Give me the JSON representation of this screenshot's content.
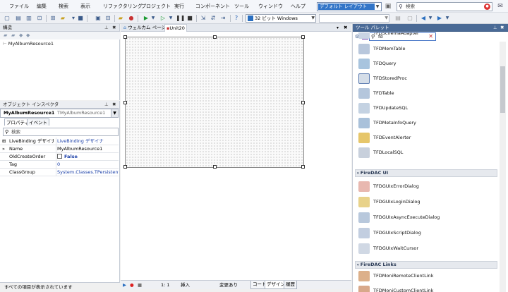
{
  "menu": [
    "ファイル",
    "編集",
    "検索",
    "表示",
    "リファクタリング",
    "プロジェクト",
    "実行",
    "コンポーネント",
    "ツール",
    "ウィンドウ",
    "ヘルプ"
  ],
  "layout_combo": "デフォルト レイアウト",
  "search": {
    "placeholder": "検索"
  },
  "platform_combo": "32 ビット Windows",
  "structure": {
    "title": "構造",
    "tree_item": "MyAlbumResource1"
  },
  "inspector": {
    "title": "オブジェクト インスペクタ",
    "object_name": "MyAlbumResource1",
    "object_type": "TMyAlbumResource1",
    "tabs": [
      "プロパティ",
      "イベント"
    ],
    "search_placeholder": "検索",
    "properties": [
      {
        "mark": "⊞",
        "key": "LiveBinding デザイナ",
        "value": "LiveBinding デザイナ",
        "blue": true
      },
      {
        "mark": "»",
        "key": "Name",
        "value": "MyAlbumResource1",
        "blue": false
      },
      {
        "mark": "",
        "key": "OldCreateOrder",
        "value": "False",
        "blue": true,
        "checkbox": true
      },
      {
        "mark": "",
        "key": "Tag",
        "value": "0",
        "blue": true
      },
      {
        "mark": "",
        "key": "ClassGroup",
        "value": "System.Classes.TPersistent",
        "blue": true
      }
    ],
    "status": "すべての項目が表示されています"
  },
  "designer": {
    "tabs": [
      "ウェルカム ページ",
      "Unit20"
    ],
    "status": {
      "position": "1:  1",
      "mode": "挿入",
      "modified": "変更あり"
    },
    "bottom_tabs": [
      "コード",
      "デザイン",
      "履歴"
    ]
  },
  "palette": {
    "title": "ツール パレット",
    "search_value": "fd",
    "items_a": [
      "TFDSchemaAdapter",
      "TFDMemTable",
      "TFDQuery",
      "TFDStoredProc",
      "TFDTable",
      "TFDUpdateSQL",
      "TFDMetaInfoQuery",
      "TFDEventAlerter",
      "TFDLocalSQL"
    ],
    "cat_ui": "FireDAC UI",
    "items_b": [
      "TFDGUIxErrorDialog",
      "TFDGUIxLoginDialog",
      "TFDGUIxAsyncExecuteDialog",
      "TFDGUIxScriptDialog",
      "TFDGUIxWaitCursor"
    ],
    "cat_links": "FireDAC Links",
    "items_c": [
      "TFDMoniRemoteClientLink",
      "TFDMoniCustomClientLink"
    ]
  }
}
